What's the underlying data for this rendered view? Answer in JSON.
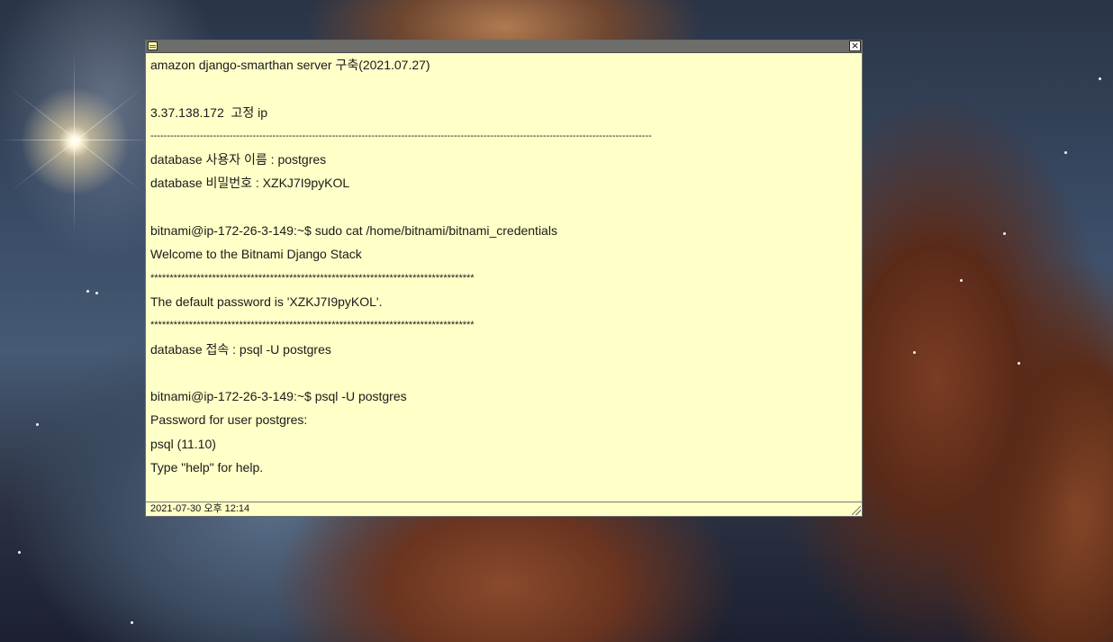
{
  "note": {
    "lines": [
      "amazon django-smarthan server 구축(2021.07.27)",
      "",
      "3.37.138.172  고정 ip",
      "--------------------------------------------------------------------------------------------------------------------------------------------------------",
      "database 사용자 이름 : postgres",
      "database 비밀번호 : XZKJ7I9pyKOL",
      "",
      "bitnami@ip-172-26-3-149:~$ sudo cat /home/bitnami/bitnami_credentials",
      "Welcome to the Bitnami Django Stack",
      "************************************************************************************",
      "The default password is 'XZKJ7I9pyKOL'.",
      "************************************************************************************",
      "database 접속 : psql -U postgres",
      "",
      "bitnami@ip-172-26-3-149:~$ psql -U postgres",
      "Password for user postgres:",
      "psql (11.10)",
      "Type \"help\" for help."
    ],
    "footer_date": "2021-07-30 오후 12:14",
    "close_label": "×"
  },
  "colors": {
    "note_background": "#ffffc8",
    "titlebar": "#6d6e6a"
  },
  "icons": {
    "note": "note-icon",
    "close": "close-icon",
    "resize": "resize-grip-icon"
  }
}
